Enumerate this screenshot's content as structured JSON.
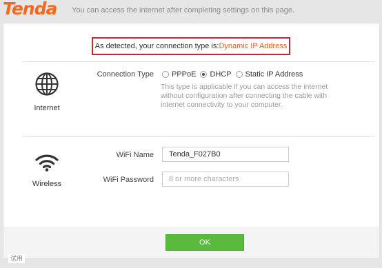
{
  "brand": {
    "logo_text": "Tenda",
    "logo_color": "#f26a21"
  },
  "header": {
    "tagline": "You can access the internet after completing settings on this page."
  },
  "banner": {
    "prefix": "As detected, your connection type is:",
    "detected_type": "Dynamic IP Address",
    "border_color": "#c8282c",
    "accent_color": "#e0601e"
  },
  "internet": {
    "icon": "globe-icon",
    "caption": "Internet",
    "connection_label": "Connection Type",
    "options": [
      {
        "label": "PPPoE",
        "selected": false
      },
      {
        "label": "DHCP",
        "selected": true
      },
      {
        "label": "Static IP Address",
        "selected": false
      }
    ],
    "help_text": "This type is applicable if you can access the internet without configuration after connecting the cable with internet connectivity to your computer."
  },
  "wireless": {
    "icon": "wifi-icon",
    "caption": "Wireless",
    "wifi_name_label": "WiFi Name",
    "wifi_name_value": "Tenda_F027B0",
    "wifi_password_label": "WiFi Password",
    "wifi_password_placeholder": "8 or more characters"
  },
  "footer": {
    "ok_label": "OK",
    "ok_color": "#5aba3c"
  },
  "watermark": {
    "text": "试用"
  }
}
